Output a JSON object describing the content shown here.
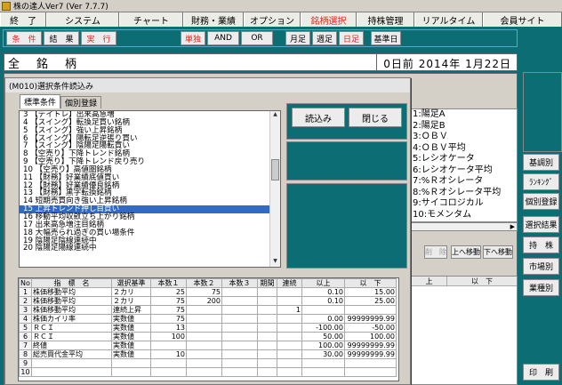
{
  "window": {
    "title": "株の達人Ver7 (Ver 7.7.7)"
  },
  "menu": [
    {
      "label": "終　了"
    },
    {
      "label": "システム"
    },
    {
      "label": "チャート"
    },
    {
      "label": "財務・業績"
    },
    {
      "label": "オプション"
    },
    {
      "label": "銘柄選択"
    },
    {
      "label": "持株管理"
    },
    {
      "label": "リアルタイム"
    },
    {
      "label": "会員サイト"
    }
  ],
  "toolbar": {
    "b1": "条　件",
    "b2": "結　果",
    "b3": "実　行",
    "b4": "単独",
    "b5": "AND",
    "b6": "OR",
    "b7": "月足",
    "b8": "週足",
    "b9": "日足",
    "b10": "基準日"
  },
  "header": {
    "title": "全　銘　柄",
    "date": "0日前 2014年 1月22日"
  },
  "right_buttons": [
    "基調別",
    "ﾗﾝｷﾝｸﾞ",
    "個別登録",
    "選択結果",
    "持　株",
    "市場別",
    "業種別",
    "印　刷"
  ],
  "dialog": {
    "title": "(M010)選択条件読込み",
    "tabs": [
      "標準条件",
      "個別登録"
    ],
    "conditions": [
      "3 【デイトレ】出来高急増",
      "4 【スイング】転換足買い銘柄",
      "5 【スイング】強い上昇銘柄",
      "6 【スイング】陽転足逆張り買い",
      "7 【スイング】陰陽足陽転買い",
      "8 【空売り】下降トレンド銘柄",
      "9 【空売り】下降トレンド戻り売り",
      "10 【空売り】高値圏銘柄",
      "11 【財務】好業績底値買い",
      "12 【財務】好業績優良銘柄",
      "13 【財務】黒字転換銘柄",
      "14 短期売買向き強い上昇銘柄",
      "15 上昇トレンド押し目買い",
      "16 移動平均収斂立ち上がり銘柄",
      "17 出来高急増注目銘柄",
      "18 大幅売られ過ぎの買い場条件",
      "19 陰陽足陰線連続中",
      "20 陰陽足陽線連続中"
    ],
    "selected_index": 12,
    "load_button": "読込み",
    "close_button": "閉じる"
  },
  "grid": {
    "headers": [
      "No",
      "指　標　名",
      "選択基準",
      "本数１",
      "本数２",
      "本数３",
      "期間",
      "連続",
      "以上",
      "以　下"
    ],
    "rows": [
      [
        "1",
        "株価移動平均",
        "２カリ",
        "25",
        "75",
        "",
        "",
        "",
        "0.10",
        "15.00"
      ],
      [
        "2",
        "株価移動平均",
        "２カリ",
        "75",
        "200",
        "",
        "",
        "",
        "0.10",
        "25.00"
      ],
      [
        "3",
        "株価移動平均",
        "連続上昇",
        "75",
        "",
        "",
        "",
        "1",
        "",
        ""
      ],
      [
        "4",
        "株価カイリ率",
        "実数値",
        "75",
        "",
        "",
        "",
        "",
        "0.00",
        "99999999.99"
      ],
      [
        "5",
        "ＲＣＩ",
        "実数値",
        "13",
        "",
        "",
        "",
        "",
        "-100.00",
        "-50.00"
      ],
      [
        "6",
        "ＲＣＩ",
        "実数値",
        "100",
        "",
        "",
        "",
        "",
        "50.00",
        "100.00"
      ],
      [
        "7",
        "終値",
        "実数値",
        "",
        "",
        "",
        "",
        "",
        "100.00",
        "99999999.99"
      ],
      [
        "8",
        "総売買代金平均",
        "実数値",
        "10",
        "",
        "",
        "",
        "",
        "30.00",
        "99999999.99"
      ],
      [
        "9",
        "",
        "",
        "",
        "",
        "",
        "",
        "",
        "",
        ""
      ],
      [
        "10",
        "",
        "",
        "",
        "",
        "",
        "",
        "",
        "",
        ""
      ]
    ]
  },
  "indicator_list": [
    "1:陽足A",
    "2:陽足B",
    "3:ＯＢＶ",
    "4:ＯＢＶ平均",
    "5:レシオケータ",
    "6:レシオケータ平均",
    "7:%Ｒオシレータ",
    "8:%Ｒオシレータ平均",
    "9:サイコロジカル",
    "10:モメンタム"
  ],
  "side_buttons": {
    "delete": "削　除",
    "up": "上へ移動",
    "down": "下へ移動"
  },
  "right_grid_headers": [
    "上",
    "以　下"
  ]
}
